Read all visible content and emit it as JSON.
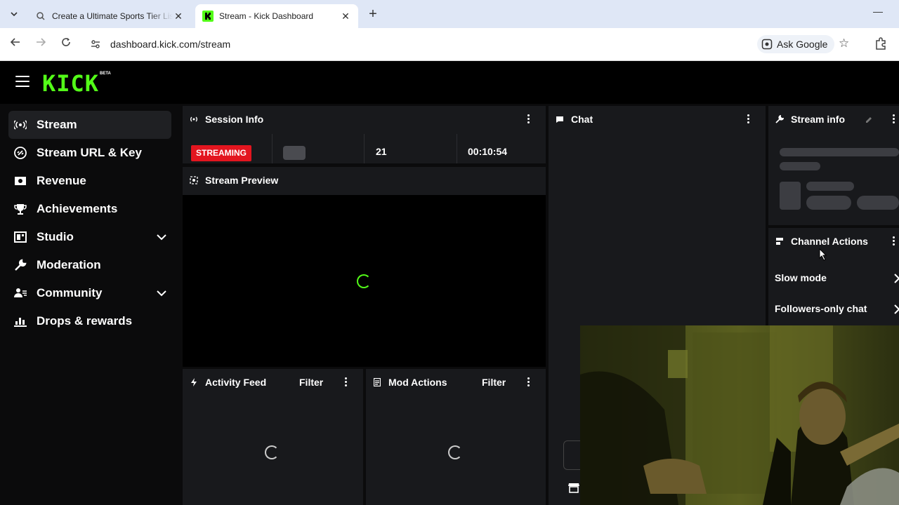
{
  "browser": {
    "tabs": [
      {
        "title": "Create a Ultimate Sports Tier List",
        "active": false
      },
      {
        "title": "Stream - Kick Dashboard",
        "active": true
      }
    ],
    "url": "dashboard.kick.com/stream",
    "ask_google": "Ask Google"
  },
  "brand": {
    "logo": "KICK",
    "badge": "BETA",
    "accent": "#53fc18"
  },
  "sidebar": {
    "items": [
      {
        "label": "Stream",
        "icon": "broadcast-icon",
        "active": true
      },
      {
        "label": "Stream URL & Key",
        "icon": "link-icon"
      },
      {
        "label": "Revenue",
        "icon": "money-icon"
      },
      {
        "label": "Achievements",
        "icon": "trophy-icon"
      },
      {
        "label": "Studio",
        "icon": "studio-icon",
        "expandable": true
      },
      {
        "label": "Moderation",
        "icon": "wrench-icon"
      },
      {
        "label": "Community",
        "icon": "people-icon",
        "expandable": true
      },
      {
        "label": "Drops & rewards",
        "icon": "chart-icon"
      }
    ]
  },
  "session": {
    "title": "Session Info",
    "status": "STREAMING",
    "viewers": "21",
    "duration": "00:10:54"
  },
  "preview": {
    "title": "Stream Preview"
  },
  "chat": {
    "title": "Chat"
  },
  "stream_info": {
    "title": "Stream info"
  },
  "channel_actions": {
    "title": "Channel Actions",
    "items": [
      "Slow mode",
      "Followers-only chat"
    ]
  },
  "activity": {
    "title": "Activity Feed",
    "filter": "Filter"
  },
  "mod_actions": {
    "title": "Mod Actions",
    "filter": "Filter"
  }
}
